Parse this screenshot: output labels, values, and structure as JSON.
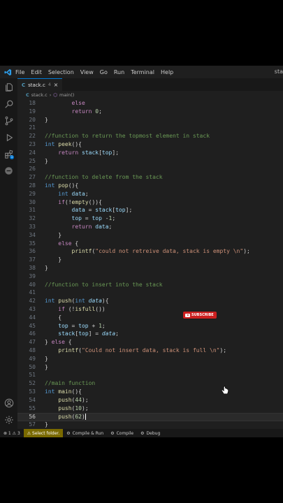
{
  "menu": {
    "items": [
      "File",
      "Edit",
      "Selection",
      "View",
      "Go",
      "Run",
      "Terminal",
      "Help"
    ],
    "window_title": "sta"
  },
  "tab": {
    "label": "stack.c",
    "count": "4",
    "close": "×"
  },
  "breadcrumb": {
    "file": "stack.c",
    "sep": "›",
    "symbol": "main()"
  },
  "code": [
    {
      "n": "18",
      "t": [
        [
          "",
          "        "
        ],
        [
          "ctl",
          "else"
        ]
      ]
    },
    {
      "n": "19",
      "t": [
        [
          "",
          "        "
        ],
        [
          "ctl",
          "return"
        ],
        [
          "",
          " "
        ],
        [
          "num2",
          "0"
        ],
        [
          "",
          ";"
        ]
      ]
    },
    {
      "n": "20",
      "t": [
        [
          "",
          "}"
        ]
      ]
    },
    {
      "n": "21",
      "t": []
    },
    {
      "n": "22",
      "t": [
        [
          "cm",
          "//function to return the topmost element in stack"
        ]
      ]
    },
    {
      "n": "23",
      "t": [
        [
          "k",
          "int"
        ],
        [
          "",
          " "
        ],
        [
          "fn",
          "peek"
        ],
        [
          "",
          "(){"
        ]
      ]
    },
    {
      "n": "24",
      "t": [
        [
          "",
          "    "
        ],
        [
          "ctl",
          "return"
        ],
        [
          "",
          " "
        ],
        [
          "var",
          "stack"
        ],
        [
          "",
          "["
        ],
        [
          "var",
          "top"
        ],
        [
          "",
          "];"
        ]
      ]
    },
    {
      "n": "25",
      "t": [
        [
          "",
          "}"
        ]
      ]
    },
    {
      "n": "26",
      "t": []
    },
    {
      "n": "27",
      "t": [
        [
          "cm",
          "//function to delete from the stack"
        ]
      ]
    },
    {
      "n": "28",
      "t": [
        [
          "k",
          "int"
        ],
        [
          "",
          " "
        ],
        [
          "fn",
          "pop"
        ],
        [
          "",
          "(){"
        ]
      ]
    },
    {
      "n": "29",
      "t": [
        [
          "",
          "    "
        ],
        [
          "k",
          "int"
        ],
        [
          "",
          " "
        ],
        [
          "var",
          "data"
        ],
        [
          "",
          ";"
        ]
      ]
    },
    {
      "n": "30",
      "t": [
        [
          "",
          "    "
        ],
        [
          "ctl",
          "if"
        ],
        [
          "",
          "(!"
        ],
        [
          "fn",
          "empty"
        ],
        [
          "",
          "()){"
        ]
      ]
    },
    {
      "n": "31",
      "t": [
        [
          "",
          "        "
        ],
        [
          "var",
          "data"
        ],
        [
          "",
          " = "
        ],
        [
          "var",
          "stack"
        ],
        [
          "",
          "["
        ],
        [
          "var",
          "top"
        ],
        [
          "",
          "];"
        ]
      ]
    },
    {
      "n": "32",
      "t": [
        [
          "",
          "        "
        ],
        [
          "var",
          "top"
        ],
        [
          "",
          " = "
        ],
        [
          "var",
          "top"
        ],
        [
          "",
          " -"
        ],
        [
          "num2",
          "1"
        ],
        [
          "",
          ";"
        ]
      ]
    },
    {
      "n": "33",
      "t": [
        [
          "",
          "        "
        ],
        [
          "ctl",
          "return"
        ],
        [
          "",
          " "
        ],
        [
          "var",
          "data"
        ],
        [
          "",
          ";"
        ]
      ]
    },
    {
      "n": "34",
      "t": [
        [
          "",
          "    }"
        ]
      ]
    },
    {
      "n": "35",
      "t": [
        [
          "",
          "    "
        ],
        [
          "ctl",
          "else"
        ],
        [
          "",
          " {"
        ]
      ]
    },
    {
      "n": "36",
      "t": [
        [
          "",
          "        "
        ],
        [
          "fn",
          "printf"
        ],
        [
          "",
          "("
        ],
        [
          "str",
          "\"could not retreive data, stack is empty \\n\""
        ],
        [
          "",
          ");"
        ]
      ]
    },
    {
      "n": "37",
      "t": [
        [
          "",
          "    }"
        ]
      ]
    },
    {
      "n": "38",
      "t": [
        [
          "",
          "}"
        ]
      ]
    },
    {
      "n": "39",
      "t": []
    },
    {
      "n": "40",
      "t": [
        [
          "cm",
          "//function to insert into the stack"
        ]
      ]
    },
    {
      "n": "41",
      "t": []
    },
    {
      "n": "42",
      "t": [
        [
          "k",
          "int"
        ],
        [
          "",
          " "
        ],
        [
          "fn",
          "push"
        ],
        [
          "",
          "("
        ],
        [
          "k",
          "int"
        ],
        [
          "",
          " "
        ],
        [
          "prm",
          "data"
        ],
        [
          "",
          "){"
        ]
      ]
    },
    {
      "n": "43",
      "t": [
        [
          "",
          "    "
        ],
        [
          "ctl",
          "if"
        ],
        [
          "",
          " (!"
        ],
        [
          "fn",
          "isfull"
        ],
        [
          "",
          "())"
        ]
      ]
    },
    {
      "n": "44",
      "t": [
        [
          "",
          "    {"
        ]
      ]
    },
    {
      "n": "45",
      "t": [
        [
          "",
          "    "
        ],
        [
          "var",
          "top"
        ],
        [
          "",
          " = "
        ],
        [
          "var",
          "top"
        ],
        [
          "",
          " + "
        ],
        [
          "num2",
          "1"
        ],
        [
          "",
          ";"
        ]
      ]
    },
    {
      "n": "46",
      "t": [
        [
          "",
          "    "
        ],
        [
          "var",
          "stack"
        ],
        [
          "",
          "["
        ],
        [
          "var",
          "top"
        ],
        [
          "",
          "] = "
        ],
        [
          "prm",
          "data"
        ],
        [
          "",
          ";"
        ]
      ]
    },
    {
      "n": "47",
      "t": [
        [
          "",
          "} "
        ],
        [
          "ctl",
          "else"
        ],
        [
          "",
          " {"
        ]
      ]
    },
    {
      "n": "48",
      "t": [
        [
          "",
          "    "
        ],
        [
          "fn",
          "printf"
        ],
        [
          "",
          "("
        ],
        [
          "str",
          "\"Could not insert data, stack is full \\n\""
        ],
        [
          "",
          ");"
        ]
      ]
    },
    {
      "n": "49",
      "t": [
        [
          "",
          "}"
        ]
      ]
    },
    {
      "n": "50",
      "t": [
        [
          "",
          "}"
        ]
      ]
    },
    {
      "n": "51",
      "t": []
    },
    {
      "n": "52",
      "t": [
        [
          "cm",
          "//main function"
        ]
      ]
    },
    {
      "n": "53",
      "t": [
        [
          "k",
          "int"
        ],
        [
          "",
          " "
        ],
        [
          "fn",
          "main"
        ],
        [
          "",
          "(){"
        ]
      ]
    },
    {
      "n": "54",
      "t": [
        [
          "",
          "    "
        ],
        [
          "fn",
          "push"
        ],
        [
          "",
          "("
        ],
        [
          "num2",
          "44"
        ],
        [
          "",
          ");"
        ]
      ]
    },
    {
      "n": "55",
      "t": [
        [
          "",
          "    "
        ],
        [
          "fn",
          "push"
        ],
        [
          "",
          "("
        ],
        [
          "num2",
          "10"
        ],
        [
          "",
          ");"
        ]
      ]
    },
    {
      "n": "56",
      "t": [
        [
          "",
          "    "
        ],
        [
          "fn",
          "push"
        ],
        [
          "",
          "("
        ],
        [
          "num2",
          "62"
        ],
        [
          "",
          ")"
        ]
      ]
    },
    {
      "n": "57",
      "t": [
        [
          "",
          "}"
        ]
      ]
    }
  ],
  "current_line": "56",
  "subscribe_label": "SUBSCRIBE",
  "status": {
    "problems": "⊗ 1 ⚠ 3",
    "folder": "⚠ Select folder.",
    "compile_run": "Compile & Run",
    "compile": "Compile",
    "debug": "Debug"
  },
  "colors": {
    "editor_bg": "#1f1f1f",
    "accent": "#0078d4",
    "warn_bg": "#7a6a00"
  }
}
